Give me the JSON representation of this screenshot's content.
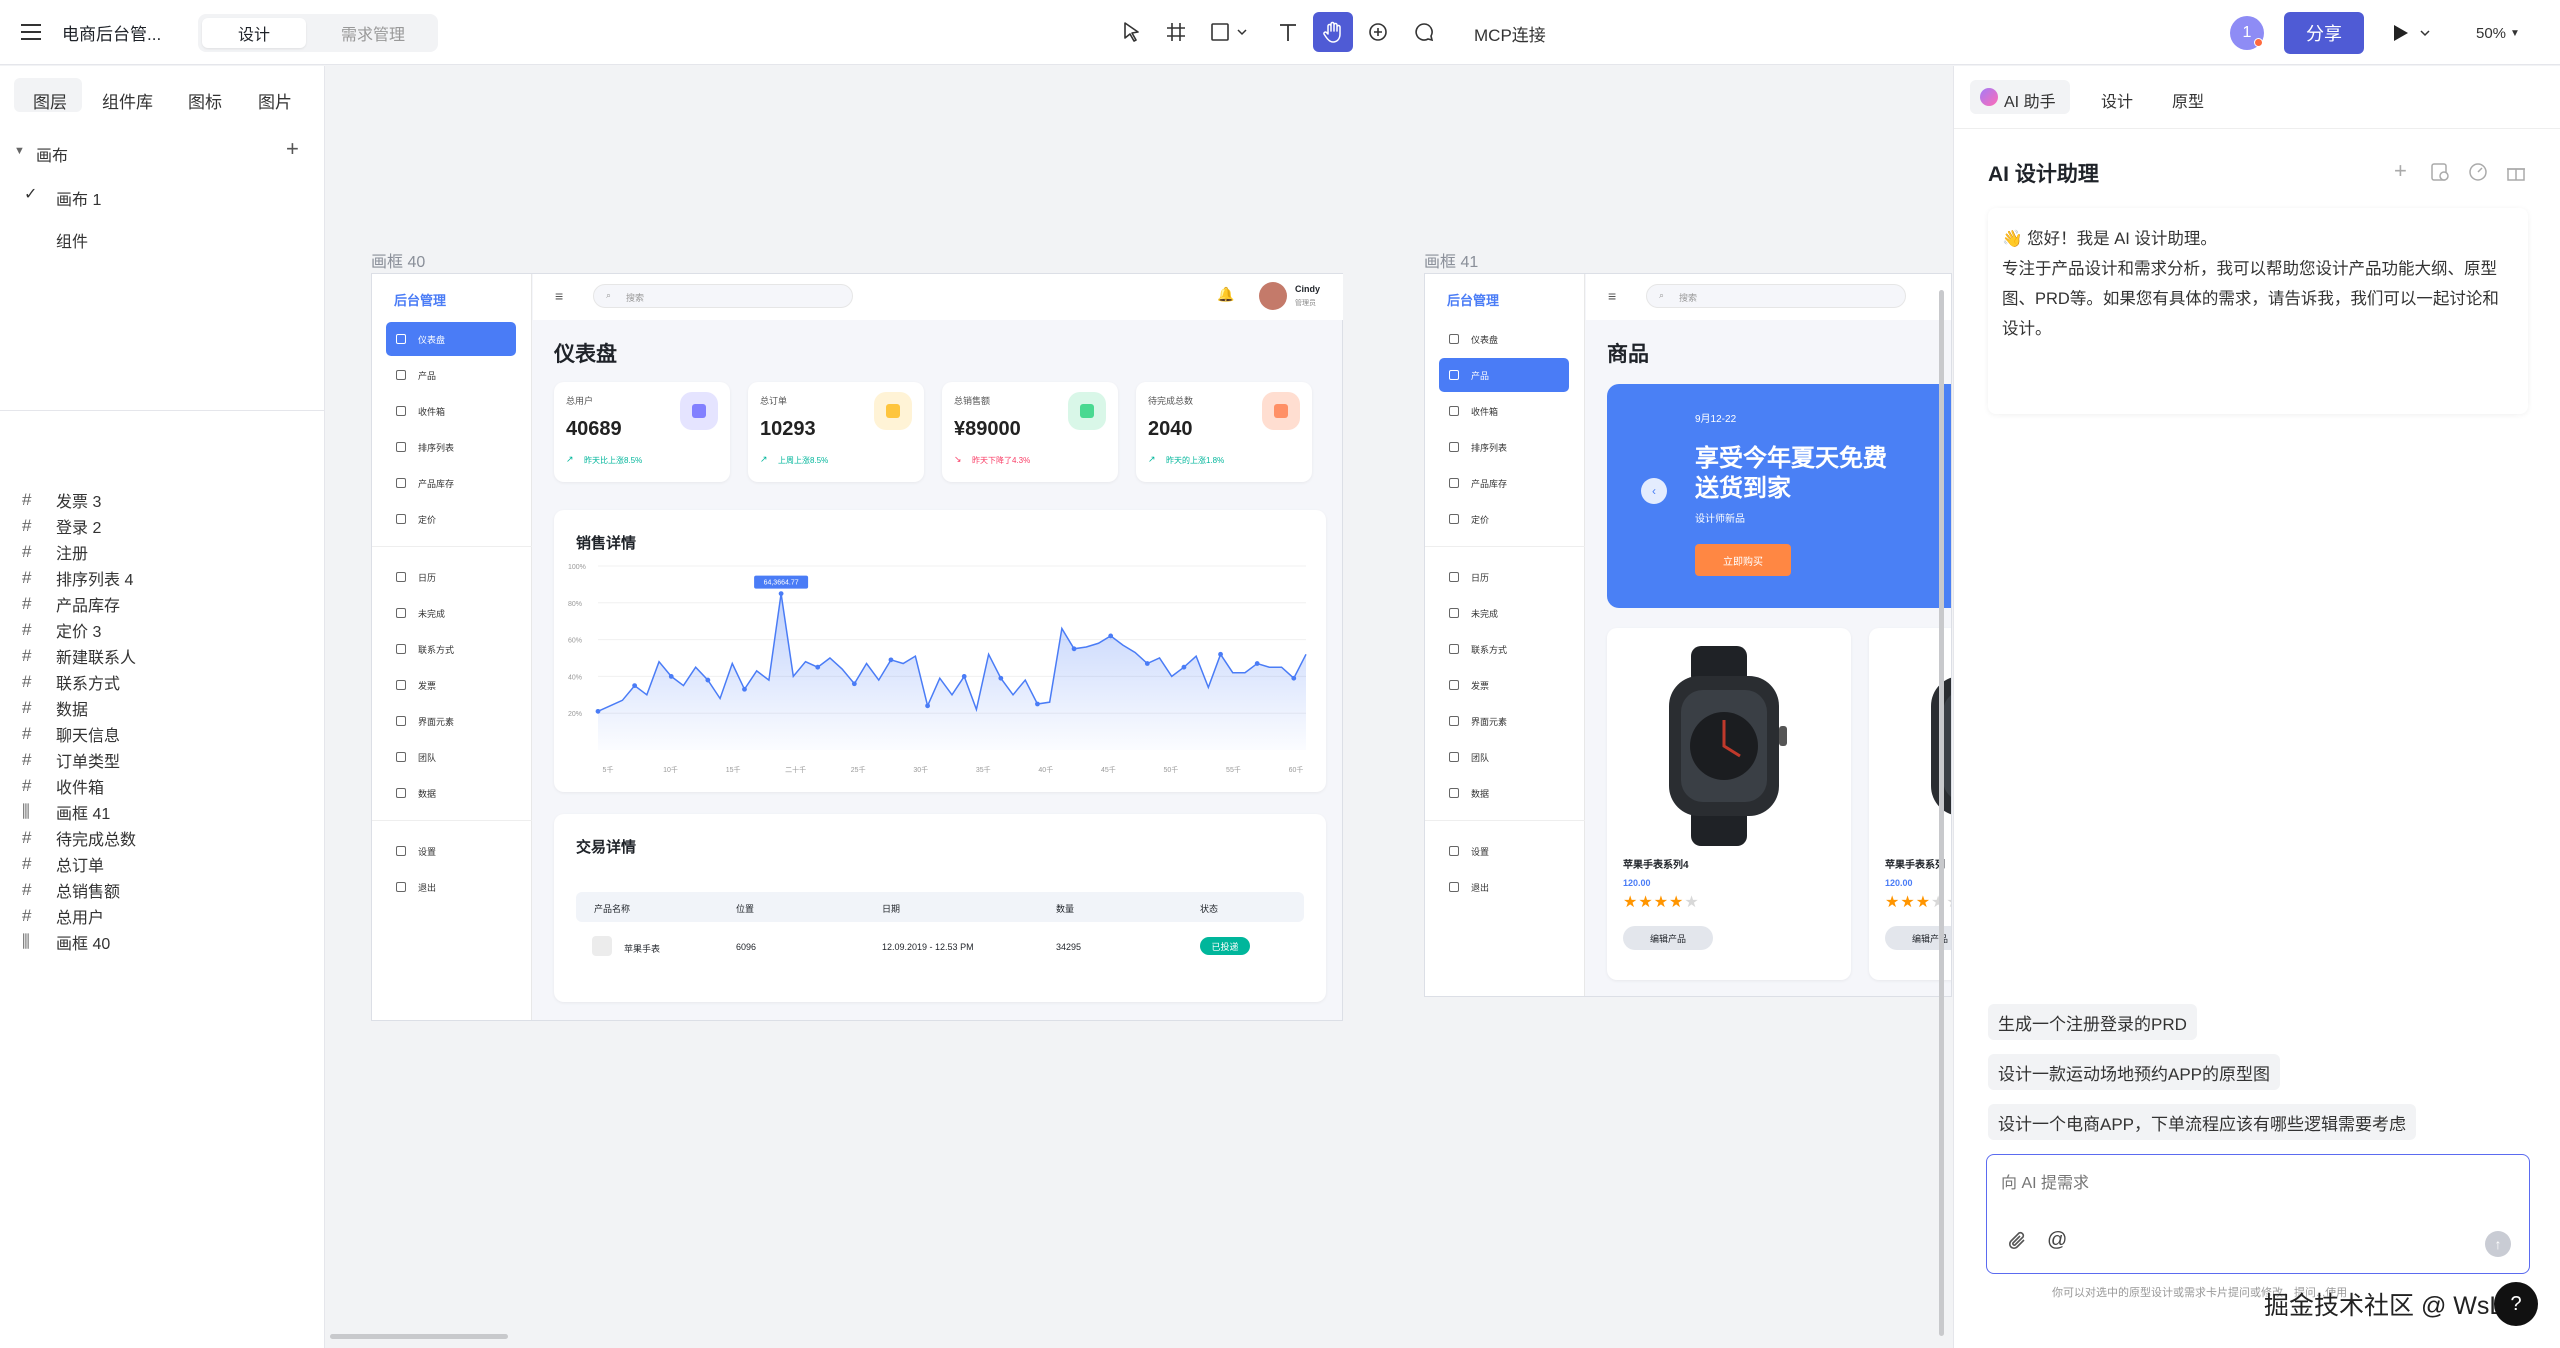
{
  "app": {
    "title": "电商后台管...",
    "mode_tabs": [
      "设计",
      "需求管理"
    ],
    "mcp": "MCP连接",
    "avatar_initial": "1",
    "share": "分享",
    "zoom": "50%"
  },
  "left": {
    "tabs": [
      "图层",
      "组件库",
      "图标",
      "图片"
    ],
    "canvas_title": "画布",
    "pages": [
      "画布 1",
      "组件"
    ],
    "layers": [
      "发票 3",
      "登录 2",
      "注册",
      "排序列表 4",
      "产品库存",
      "定价 3",
      "新建联系人",
      "联系方式",
      "数据",
      "聊天信息",
      "订单类型",
      "收件箱",
      "画框 41",
      "待完成总数",
      "总订单",
      "总销售额",
      "总用户",
      "画框 40"
    ]
  },
  "frame40": {
    "label": "画框 40",
    "brand": "后台管理",
    "search_placeholder": "搜索",
    "user_name": "Cindy",
    "user_role": "管理员",
    "page_title": "仪表盘",
    "nav": [
      "仪表盘",
      "产品",
      "收件箱",
      "排序列表",
      "产品库存",
      "定价",
      "日历",
      "未完成",
      "联系方式",
      "发票",
      "界面元素",
      "团队",
      "数据",
      "设置",
      "退出"
    ],
    "stats": [
      {
        "label": "总用户",
        "value": "40689",
        "trend": "昨天比上涨8.5%",
        "up": true,
        "color": "#8280ff",
        "bg": "#e5e4ff"
      },
      {
        "label": "总订单",
        "value": "10293",
        "trend": "上周上涨8.5%",
        "up": true,
        "color": "#fec53d",
        "bg": "#fff3d6"
      },
      {
        "label": "总销售额",
        "value": "¥89000",
        "trend": "昨天下降了4.3%",
        "up": false,
        "color": "#4ad991",
        "bg": "#d9f7e8"
      },
      {
        "label": "待完成总数",
        "value": "2040",
        "trend": "昨天的上涨1.8%",
        "up": true,
        "color": "#ff9066",
        "bg": "#ffded1"
      }
    ],
    "sales_title": "销售详情",
    "trade_title": "交易详情",
    "table_headers": [
      "产品名称",
      "位置",
      "日期",
      "数量",
      "状态"
    ],
    "table_row": {
      "name": "苹果手表",
      "loc": "6096",
      "date": "12.09.2019 - 12.53 PM",
      "qty": "34295",
      "status": "已投递"
    }
  },
  "chart_data": {
    "type": "area",
    "title": "销售详情",
    "xlabel": "",
    "ylabel": "",
    "ylim": [
      0,
      100
    ],
    "y_ticks": [
      "20%",
      "40%",
      "60%",
      "80%",
      "100%"
    ],
    "x_ticks": [
      "5千",
      "10千",
      "15千",
      "二十千",
      "25千",
      "30千",
      "35千",
      "40千",
      "45千",
      "50千",
      "55千",
      "60千"
    ],
    "values": [
      21,
      24,
      27,
      35,
      30,
      48,
      40,
      35,
      45,
      38,
      28,
      47,
      33,
      43,
      38,
      85,
      40,
      48,
      45,
      50,
      44,
      36,
      47,
      38,
      49,
      47,
      51,
      24,
      39,
      30,
      40,
      22,
      52,
      39,
      30,
      38,
      25,
      26,
      66,
      55,
      56,
      58,
      62,
      57,
      53,
      47,
      50,
      40,
      45,
      51,
      34,
      52,
      42,
      42,
      47,
      45,
      45,
      39,
      52
    ],
    "peak_label": "64,3664.77",
    "color": "#4a7cf6",
    "grid": true
  },
  "frame41": {
    "label": "画框 41",
    "brand": "后台管理",
    "search_placeholder": "搜索",
    "page_title": "商品",
    "nav": [
      "仪表盘",
      "产品",
      "收件箱",
      "排序列表",
      "产品库存",
      "定价",
      "日历",
      "未完成",
      "联系方式",
      "发票",
      "界面元素",
      "团队",
      "数据",
      "设置",
      "退出"
    ],
    "banner": {
      "date": "9月12-22",
      "line1": "享受今年夏天免费",
      "line2": "送货到家",
      "sub": "设计师新品",
      "cta": "立即购买"
    },
    "products": [
      {
        "name": "苹果手表系列4",
        "price": "120.00",
        "rating": 4,
        "btn": "编辑产品"
      },
      {
        "name": "苹果手表系列",
        "price": "120.00",
        "rating": 3,
        "btn": "编辑产品"
      }
    ]
  },
  "right": {
    "tabs": [
      "AI 助手",
      "设计",
      "原型"
    ],
    "title": "AI 设计助理",
    "greeting": "👋 您好！我是 AI 设计助理。",
    "intro": "专注于产品设计和需求分析，我可以帮助您设计产品功能大纲、原型图、PRD等。如果您有具体的需求，请告诉我，我们可以一起讨论和设计。",
    "suggestions": [
      "生成一个注册登录的PRD",
      "设计一款运动场地预约APP的原型图",
      "设计一个电商APP，下单流程应该有哪些逻辑需要考虑"
    ],
    "input_placeholder": "向 AI 提需求",
    "footer": "你可以对选中的原型设计或需求卡片提问或修改，提问...使用"
  },
  "watermark": "掘金技术社区 @ WsLeo"
}
